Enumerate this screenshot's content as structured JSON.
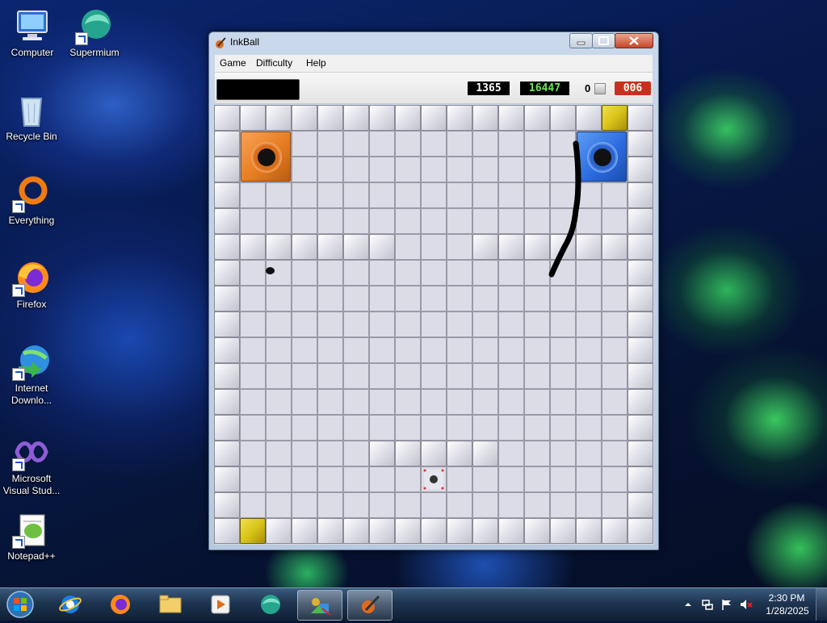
{
  "desktop": {
    "icons": [
      {
        "id": "computer",
        "label": "Computer",
        "icon": "computer-icon"
      },
      {
        "id": "supermium",
        "label": "Supermium",
        "icon": "supermium-icon"
      },
      {
        "id": "recycle-bin",
        "label": "Recycle Bin",
        "icon": "recycle-bin-icon"
      },
      {
        "id": "everything",
        "label": "Everything",
        "icon": "everything-icon"
      },
      {
        "id": "firefox",
        "label": "Firefox",
        "icon": "firefox-icon"
      },
      {
        "id": "idm",
        "label": "Internet Downlo...",
        "icon": "internet-download-manager-icon"
      },
      {
        "id": "vs",
        "label": "Microsoft Visual Stud...",
        "icon": "visual-studio-icon"
      },
      {
        "id": "notepadpp",
        "label": "Notepad++",
        "icon": "notepadpp-icon"
      }
    ]
  },
  "window": {
    "title": "InkBall",
    "icon": "inkball-icon",
    "menu": [
      "Game",
      "Difficulty",
      "Help"
    ],
    "controls": [
      "minimize",
      "maximize",
      "close"
    ]
  },
  "scoreboard": {
    "ink_remaining": 0,
    "score": "1365",
    "high_score": "16447",
    "balls_captured": "0",
    "timer": "006",
    "colors": {
      "score": "#ffffff",
      "high_score": "#6fe65b",
      "timer_bg": "#c8301e"
    }
  },
  "board": {
    "grid_cols": 17,
    "grid_rows": 17,
    "holes": [
      {
        "color": "orange",
        "hex": "#e77d20"
      },
      {
        "color": "blue",
        "hex": "#2d6de0"
      }
    ],
    "yellow_blocks": 2,
    "ball_color": "black",
    "ink_line_color": "black"
  },
  "taskbar": {
    "items": [
      {
        "icon": "start-orb-icon",
        "active": false
      },
      {
        "icon": "internet-explorer-icon",
        "active": false
      },
      {
        "icon": "firefox-icon",
        "active": false
      },
      {
        "icon": "file-explorer-icon",
        "active": false
      },
      {
        "icon": "media-player-icon",
        "active": false
      },
      {
        "icon": "supermium-icon",
        "active": false
      },
      {
        "icon": "games-icon",
        "active": true
      },
      {
        "icon": "inkball-icon",
        "active": true
      }
    ],
    "tray": {
      "icons": [
        "show-hidden-icons-chevron",
        "network-icon",
        "action-center-flag-icon",
        "volume-muted-icon"
      ],
      "time": "2:30 PM",
      "date": "1/28/2025"
    }
  }
}
